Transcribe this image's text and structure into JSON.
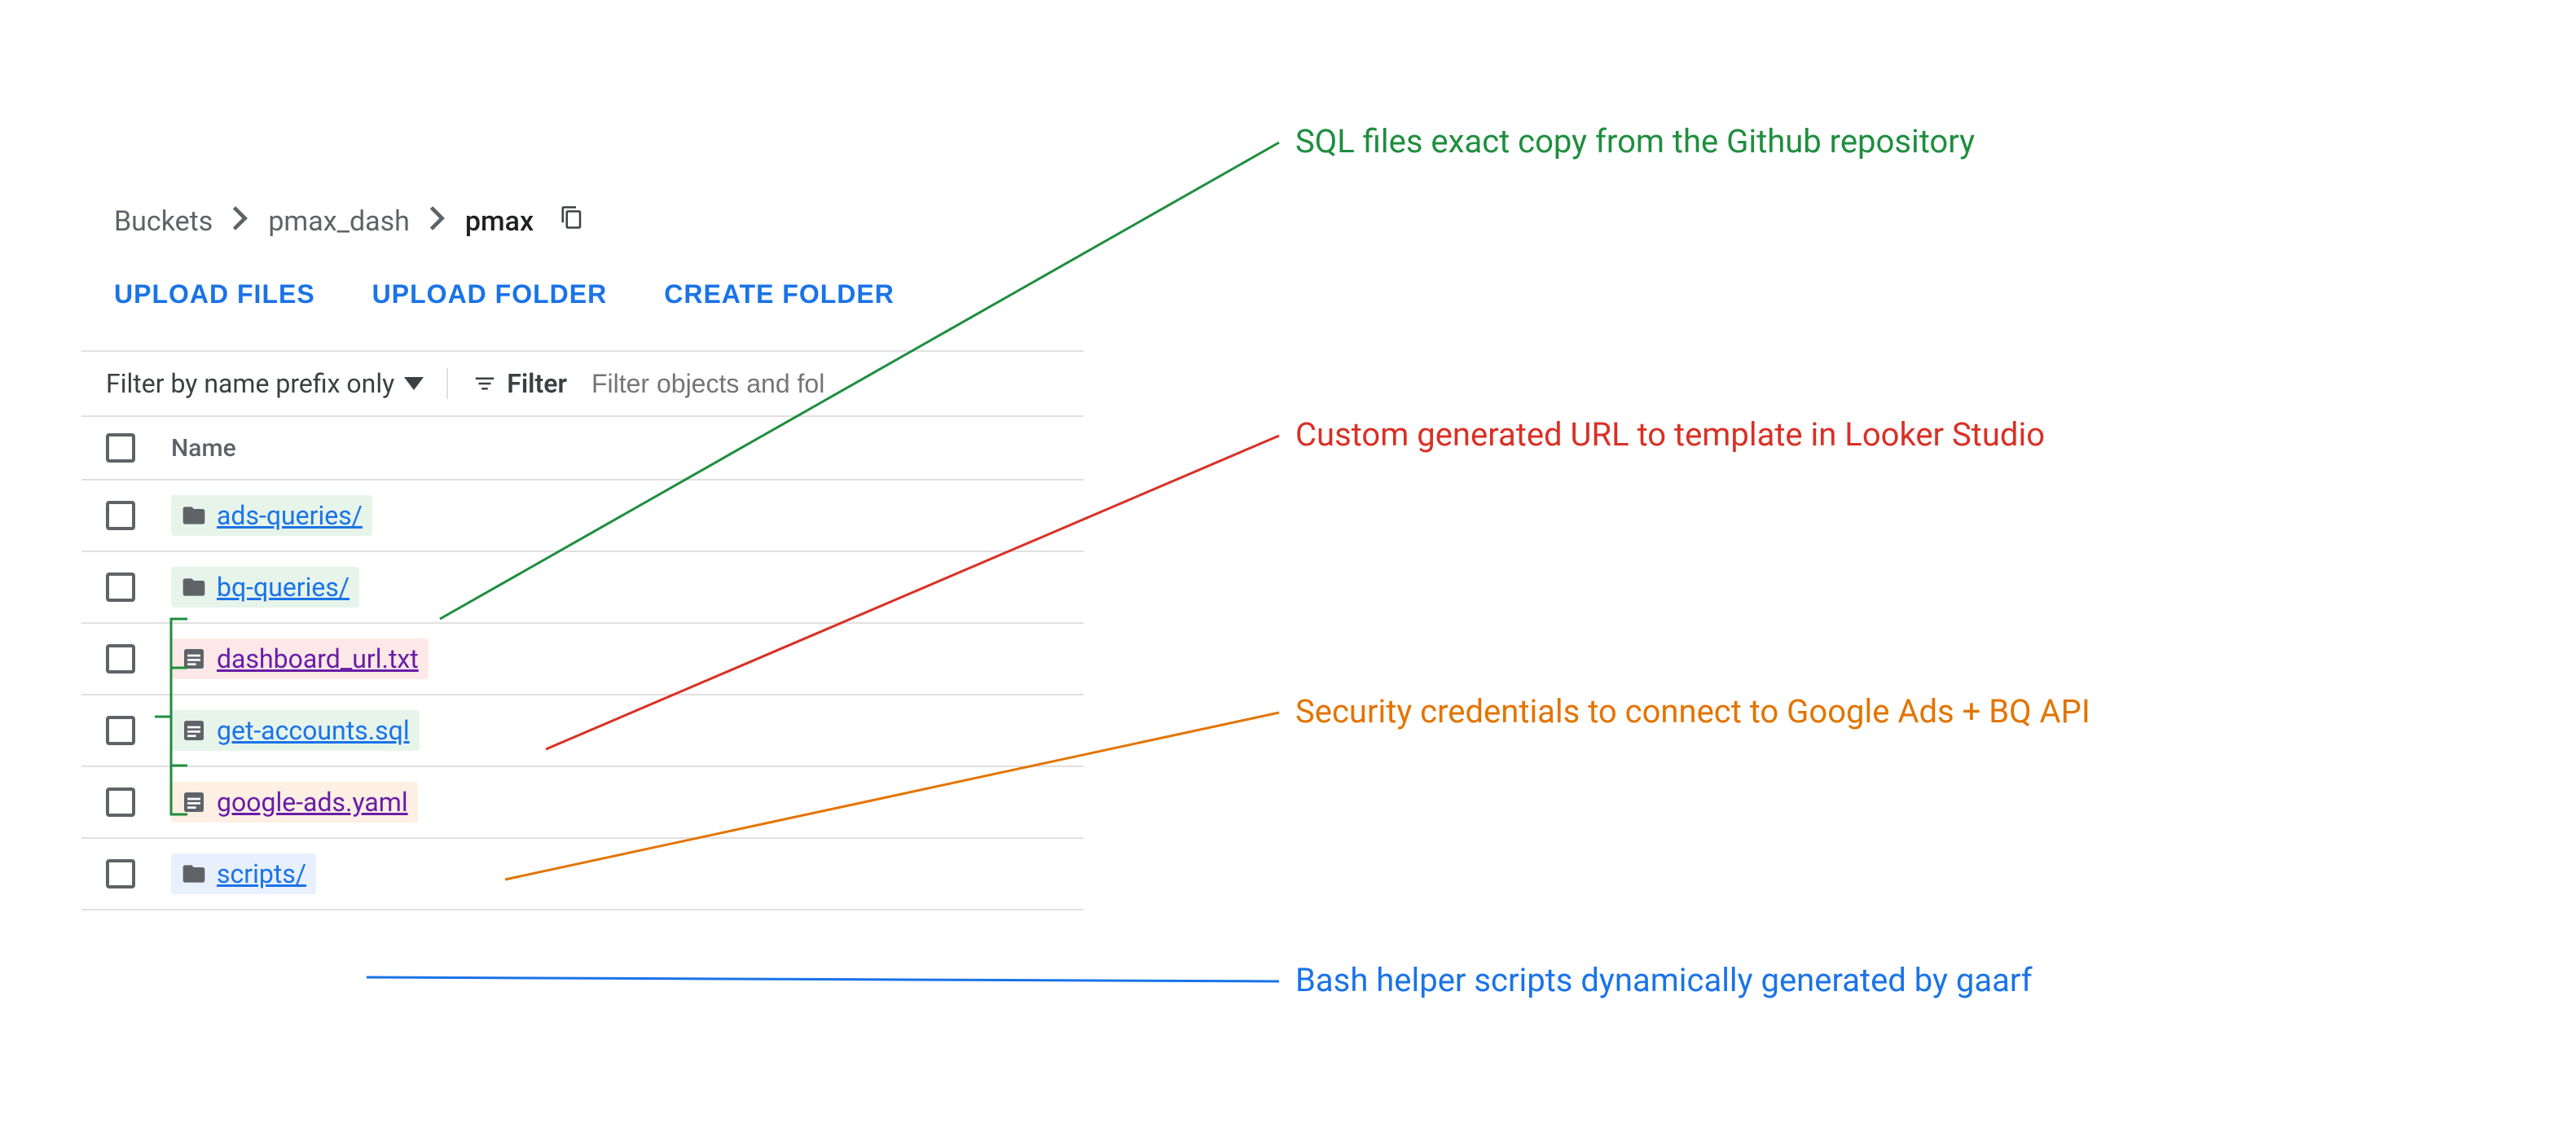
{
  "breadcrumb": {
    "root": "Buckets",
    "mid": "pmax_dash",
    "current": "pmax"
  },
  "actions": {
    "upload_files": "UPLOAD FILES",
    "upload_folder": "UPLOAD FOLDER",
    "create_folder": "CREATE FOLDER"
  },
  "filter": {
    "dropdown": "Filter by name prefix only",
    "label": "Filter",
    "placeholder": "Filter objects and fol"
  },
  "table": {
    "header_name": "Name"
  },
  "items": [
    {
      "name": "ads-queries/",
      "type": "folder",
      "highlight": "green",
      "visited": false
    },
    {
      "name": "bq-queries/",
      "type": "folder",
      "highlight": "green",
      "visited": false
    },
    {
      "name": "dashboard_url.txt",
      "type": "file",
      "highlight": "red",
      "visited": true
    },
    {
      "name": "get-accounts.sql",
      "type": "file",
      "highlight": "green",
      "visited": false
    },
    {
      "name": "google-ads.yaml",
      "type": "file",
      "highlight": "orange",
      "visited": true
    },
    {
      "name": "scripts/",
      "type": "folder",
      "highlight": "blue",
      "visited": false
    }
  ],
  "annotations": {
    "sql": "SQL files exact copy from the Github repository",
    "url": "Custom generated URL to template in Looker Studio",
    "security": "Security credentials to connect to Google Ads + BQ API",
    "bash": "Bash helper scripts dynamically generated by gaarf"
  }
}
